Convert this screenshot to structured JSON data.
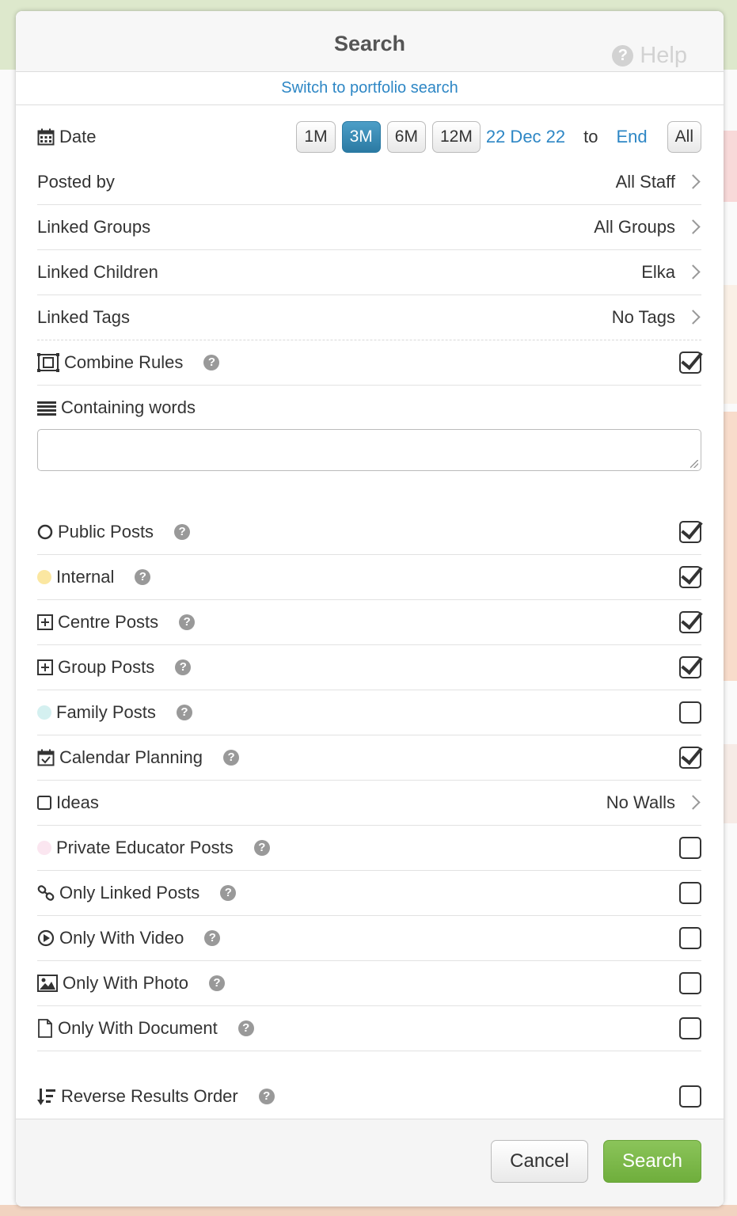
{
  "modal": {
    "title": "Search",
    "help": "Help",
    "switch_link": "Switch to portfolio search"
  },
  "date": {
    "label": "Date",
    "buttons": [
      "1M",
      "3M",
      "6M",
      "12M"
    ],
    "active": "3M",
    "from": "22 Dec 22",
    "to_label": "to",
    "end": "End",
    "all": "All"
  },
  "filters": {
    "posted_by": {
      "label": "Posted by",
      "value": "All Staff"
    },
    "linked_groups": {
      "label": "Linked Groups",
      "value": "All Groups"
    },
    "linked_children": {
      "label": "Linked Children",
      "value": "Elka"
    },
    "linked_tags": {
      "label": "Linked Tags",
      "value": "No Tags"
    },
    "combine_rules": {
      "label": "Combine Rules",
      "checked": true
    },
    "containing_words": {
      "label": "Containing words",
      "value": ""
    }
  },
  "post_types": {
    "public": {
      "label": "Public Posts",
      "checked": true
    },
    "internal": {
      "label": "Internal",
      "checked": true,
      "color": "#fbe7a1"
    },
    "centre": {
      "label": "Centre Posts",
      "checked": true
    },
    "group": {
      "label": "Group Posts",
      "checked": true
    },
    "family": {
      "label": "Family Posts",
      "checked": false,
      "color": "#d4f0f0"
    },
    "calendar": {
      "label": "Calendar Planning",
      "checked": true
    },
    "ideas": {
      "label": "Ideas",
      "value": "No Walls"
    },
    "private": {
      "label": "Private Educator Posts",
      "checked": false,
      "color": "#fbe6f0"
    },
    "only_linked": {
      "label": "Only Linked Posts",
      "checked": false
    },
    "only_video": {
      "label": "Only With Video",
      "checked": false
    },
    "only_photo": {
      "label": "Only With Photo",
      "checked": false
    },
    "only_document": {
      "label": "Only With Document",
      "checked": false
    }
  },
  "reverse": {
    "label": "Reverse Results Order",
    "checked": false
  },
  "footer": {
    "cancel": "Cancel",
    "search": "Search"
  },
  "colors": {
    "accent": "#2e87c5",
    "active_btn": "#3a8ab5",
    "search_btn": "#7cb84a"
  }
}
